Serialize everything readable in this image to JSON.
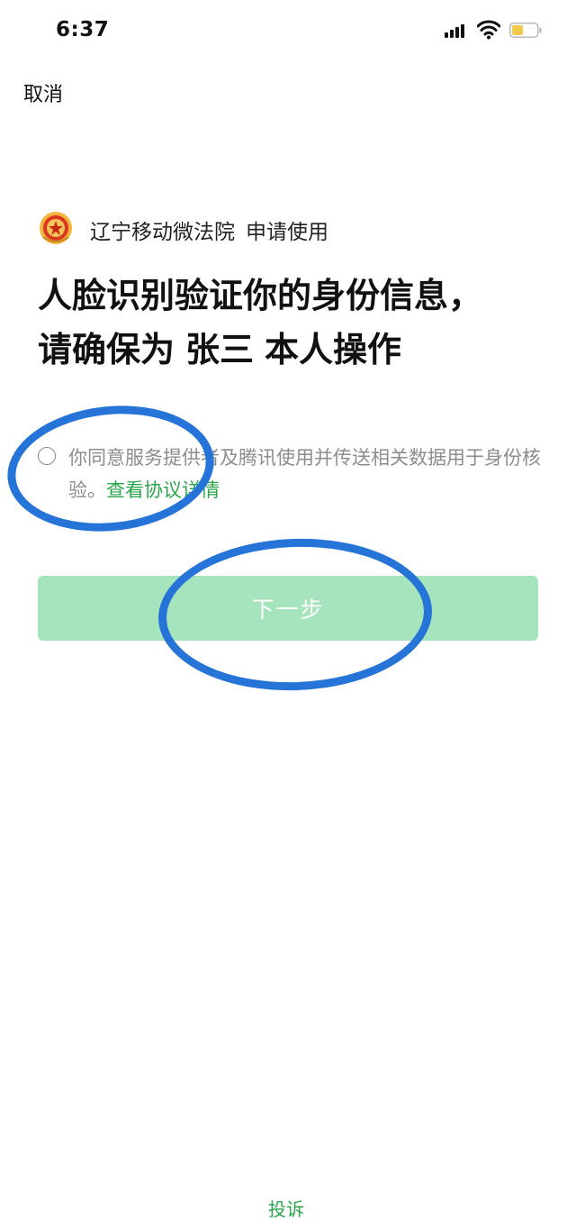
{
  "status_bar": {
    "time": "6:37",
    "icons": [
      "cellular-signal-icon",
      "wifi-icon",
      "battery-icon"
    ],
    "battery_color": "#f2c94c"
  },
  "header": {
    "cancel_label": "取消"
  },
  "app": {
    "logo_icon": "court-emblem-icon",
    "name": "辽宁移动微法院",
    "action": "申请使用"
  },
  "headline": {
    "line1": "人脸识别验证你的身份信息，",
    "line2_prefix": "请确保为",
    "line2_name": "张三",
    "line2_suffix": "本人操作"
  },
  "agreement": {
    "checked": false,
    "text": "你同意服务提供者及腾讯使用并传送相关数据用于身份核验。",
    "link_label": "查看协议详情"
  },
  "next_button": {
    "label": "下一步",
    "enabled": false,
    "color": "#a5e4bd"
  },
  "footer": {
    "complaint_label": "投诉"
  },
  "colors": {
    "accent_green": "#2aa54c",
    "annotation_blue": "#2674d7"
  }
}
